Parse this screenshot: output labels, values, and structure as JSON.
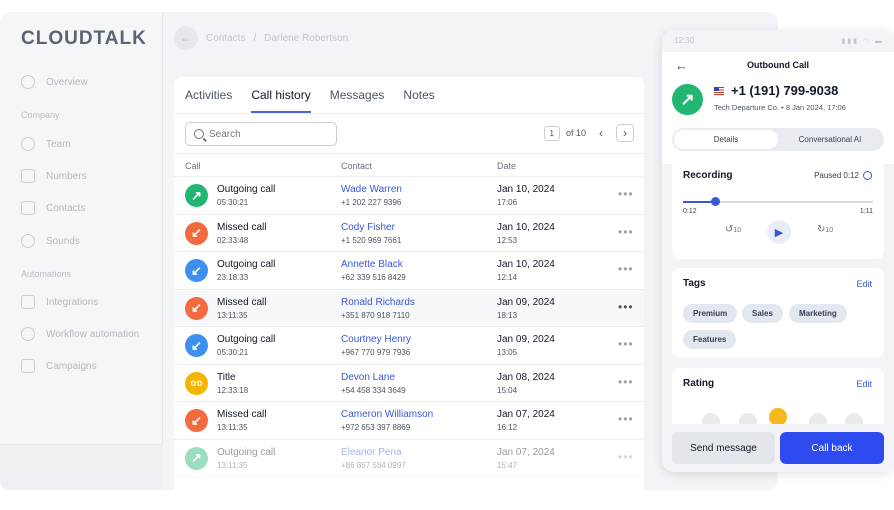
{
  "brand": "CLOUDTALK",
  "nav": {
    "overview": "Overview",
    "section_company": "Company",
    "team": "Team",
    "numbers": "Numbers",
    "contacts": "Contacts",
    "sounds": "Sounds",
    "section_automations": "Automations",
    "integrations": "Integrations",
    "workflow": "Workflow automation",
    "campaigns": "Campaigns"
  },
  "breadcrumb": {
    "parent": "Contacts",
    "separator": "/",
    "current": "Darlene Robertson"
  },
  "tabs": [
    "Activities",
    "Call history",
    "Messages",
    "Notes"
  ],
  "search": {
    "placeholder": "Search"
  },
  "pager": {
    "page": "1",
    "of": "of 10"
  },
  "table": {
    "headers": {
      "call": "Call",
      "contact": "Contact",
      "date": "Date"
    },
    "rows": [
      {
        "type": "Outgoing call",
        "duration": "05:30:21",
        "name": "Wade Warren",
        "phone": "+1 202 227 9396",
        "date": "Jan 10, 2024",
        "time": "17:06"
      },
      {
        "type": "Missed call",
        "duration": "02:33:48",
        "name": "Cody Fisher",
        "phone": "+1 520 969 7661",
        "date": "Jan 10, 2024",
        "time": "12:53"
      },
      {
        "type": "Outgoing call",
        "duration": "23:18:33",
        "name": "Annette Black",
        "phone": "+62 339 516 8429",
        "date": "Jan 10, 2024",
        "time": "12:14"
      },
      {
        "type": "Missed call",
        "duration": "13:11:35",
        "name": "Ronald Richards",
        "phone": "+351 870 918 7110",
        "date": "Jan 09, 2024",
        "time": "18:13"
      },
      {
        "type": "Outgoing call",
        "duration": "05:30:21",
        "name": "Courtney Henry",
        "phone": "+967 770 979 7936",
        "date": "Jan 09, 2024",
        "time": "13:05"
      },
      {
        "type": "Title",
        "duration": "12:33:18",
        "name": "Devon Lane",
        "phone": "+54 458 334 3649",
        "date": "Jan 08, 2024",
        "time": "15:04"
      },
      {
        "type": "Missed call",
        "duration": "13:11:35",
        "name": "Cameron Williamson",
        "phone": "+972 653 397 8869",
        "date": "Jan 07, 2024",
        "time": "16:12"
      },
      {
        "type": "Outgoing call",
        "duration": "13:11:35",
        "name": "Eleanor Pena",
        "phone": "+86 857 584 0997",
        "date": "Jan 07, 2024",
        "time": "15:47"
      }
    ],
    "more": "•••"
  },
  "phone": {
    "status_time": "12:30",
    "title": "Outbound Call",
    "number": "+1 (191) 799-9038",
    "subtitle": "Tech Departure Co.  •  8 Jan 2024,  17:06",
    "segments": [
      "Details",
      "Conversational AI"
    ],
    "recording": {
      "title": "Recording",
      "status": "Paused 0:12",
      "elapsed": "0:12",
      "total": "1:11",
      "progress": 0.17,
      "skip": "10"
    },
    "tags": {
      "title": "Tags",
      "edit": "Edit",
      "items": [
        "Premium",
        "Sales",
        "Marketing",
        "Features"
      ]
    },
    "rating": {
      "title": "Rating",
      "edit": "Edit"
    },
    "actions": {
      "send": "Send message",
      "call_back": "Call back"
    }
  },
  "colors": {
    "accent": "#3a57d6",
    "call_button": "#2e4bf0",
    "outgoing": "#22b573",
    "missed": "#f26a3d",
    "incoming": "#3d8ff0",
    "voicemail": "#f5b400"
  }
}
